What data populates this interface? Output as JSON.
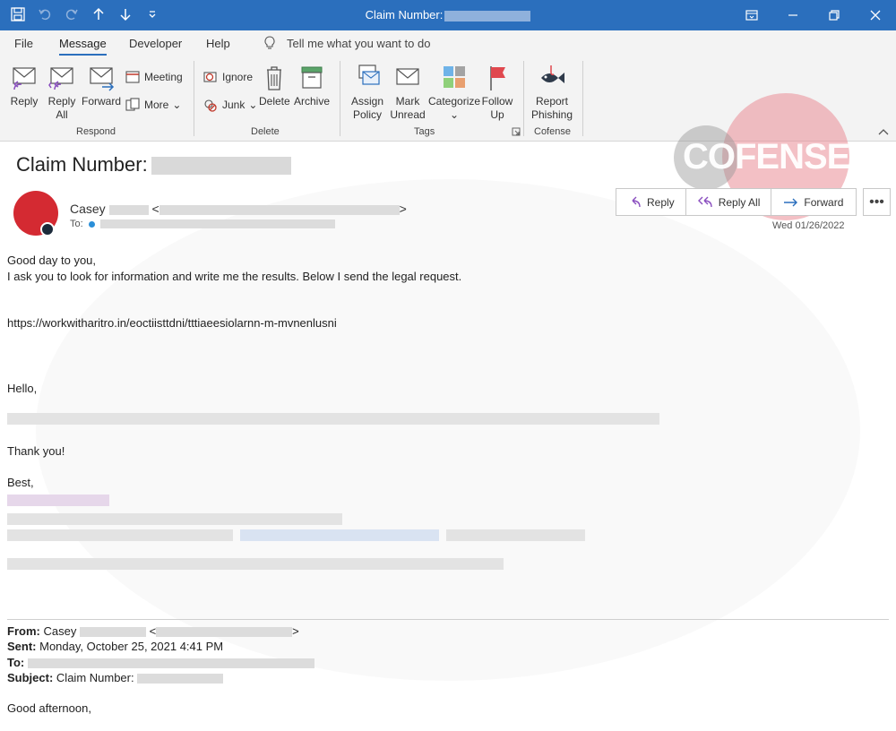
{
  "window": {
    "title": "Claim Number:"
  },
  "ribbon_tabs": [
    "File",
    "Message",
    "Developer",
    "Help"
  ],
  "tell_me": "Tell me what you want to do",
  "ribbon": {
    "reply": "Reply",
    "reply_all": "Reply All",
    "forward": "Forward",
    "meeting": "Meeting",
    "more": "More",
    "ignore": "Ignore",
    "junk": "Junk",
    "delete": "Delete",
    "archive": "Archive",
    "assign_policy": "Assign Policy",
    "mark_unread": "Mark Unread",
    "categorize": "Categorize",
    "follow_up": "Follow Up",
    "report_phishing": "Report Phishing",
    "groups": {
      "respond": "Respond",
      "delete": "Delete",
      "tags": "Tags",
      "cofense": "Cofense"
    }
  },
  "watermark": "COFENSE",
  "message": {
    "subject": "Claim Number:",
    "sender_name": "Casey",
    "to_label": "To:",
    "date": "Wed 01/26/2022",
    "actions": {
      "reply": "Reply",
      "reply_all": "Reply All",
      "forward": "Forward",
      "more": "•••"
    }
  },
  "body": {
    "greeting": "Good day to you,",
    "line1": "I ask you to look for information and write me the results. Below I send the legal request.",
    "url": "https://workwitharitro.in/eoctiisttdni/tttiaeesiolarnn-m-mvnenlusni",
    "hello": "Hello,",
    "thanks": "Thank you!",
    "best": "Best,"
  },
  "forwarded": {
    "from_label": "From:",
    "from_value": "Casey",
    "sent_label": "Sent:",
    "sent_value": "Monday, October 25, 2021 4:41 PM",
    "to_label": "To:",
    "subject_label": "Subject:",
    "subject_value": "Claim Number:",
    "greeting": "Good afternoon,"
  },
  "colors": {
    "titlebar": "#2b6fbd",
    "avatar": "#d42a32",
    "accent": "#2b6fbd"
  }
}
